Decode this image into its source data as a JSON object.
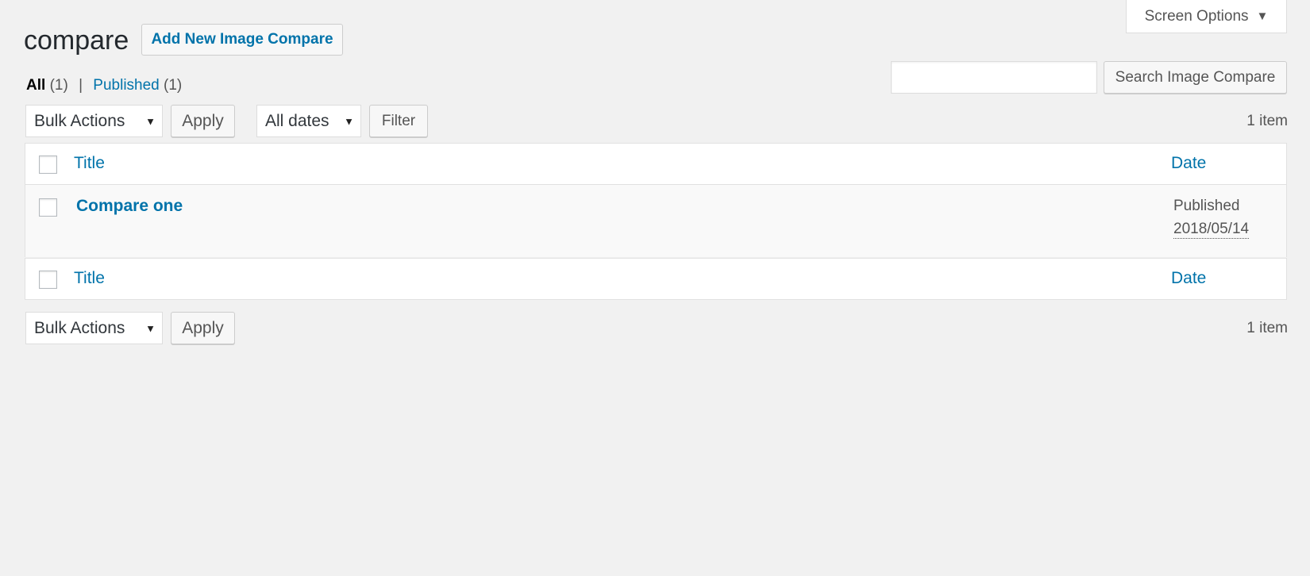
{
  "screen_options": {
    "label": "Screen Options"
  },
  "page": {
    "title": "compare",
    "add_new_label": "Add New Image Compare"
  },
  "views": {
    "all_label": "All",
    "all_count": "(1)",
    "separator": "|",
    "published_label": "Published",
    "published_count": "(1)"
  },
  "search": {
    "value": "",
    "button_label": "Search Image Compare"
  },
  "tablenav_top": {
    "bulk_actions": "Bulk Actions",
    "apply_label": "Apply",
    "dates": "All dates",
    "filter_label": "Filter",
    "count": "1 item"
  },
  "table": {
    "columns": {
      "title": "Title",
      "date": "Date"
    },
    "rows": [
      {
        "title": "Compare one",
        "status": "Published",
        "date": "2018/05/14"
      }
    ]
  },
  "tablenav_bottom": {
    "bulk_actions": "Bulk Actions",
    "apply_label": "Apply",
    "count": "1 item"
  }
}
